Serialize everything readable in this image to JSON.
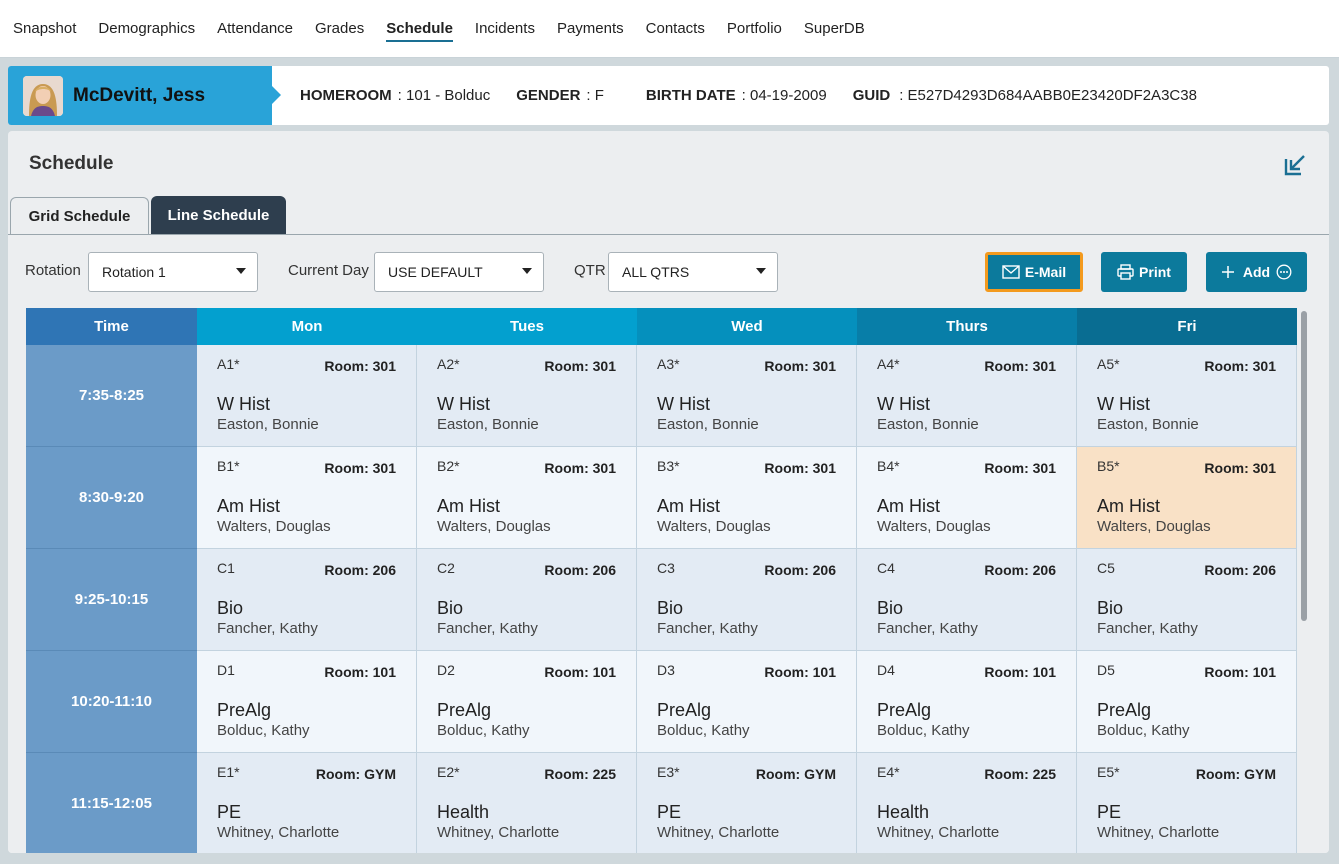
{
  "nav": {
    "items": [
      {
        "label": "Snapshot",
        "name": "nav-snapshot",
        "active": false
      },
      {
        "label": "Demographics",
        "name": "nav-demographics",
        "active": false
      },
      {
        "label": "Attendance",
        "name": "nav-attendance",
        "active": false
      },
      {
        "label": "Grades",
        "name": "nav-grades",
        "active": false
      },
      {
        "label": "Schedule",
        "name": "nav-schedule",
        "active": true
      },
      {
        "label": "Incidents",
        "name": "nav-incidents",
        "active": false
      },
      {
        "label": "Payments",
        "name": "nav-payments",
        "active": false
      },
      {
        "label": "Contacts",
        "name": "nav-contacts",
        "active": false
      },
      {
        "label": "Portfolio",
        "name": "nav-portfolio",
        "active": false
      },
      {
        "label": "SuperDB",
        "name": "nav-superdb",
        "active": false
      }
    ]
  },
  "student": {
    "name": "McDevitt, Jess",
    "homeroom_label": "HOMEROOM",
    "homeroom": ": 101 - Bolduc",
    "gender_label": "GENDER",
    "gender": ": F",
    "birthdate_label": "BIRTH DATE",
    "birthdate": ": 04-19-2009",
    "guid_label": "GUID",
    "guid": ": E527D4293D684AABB0E23420DF2A3C38"
  },
  "panel": {
    "title": "Schedule",
    "tabs": {
      "grid": "Grid Schedule",
      "line": "Line Schedule"
    }
  },
  "filters": {
    "rotation_label": "Rotation",
    "rotation_value": "Rotation 1",
    "current_day_label": "Current Day",
    "current_day_value": "USE DEFAULT",
    "qtr_label": "QTR",
    "qtr_value": "ALL QTRS"
  },
  "buttons": {
    "email": "E-Mail",
    "print": "Print",
    "add": "Add"
  },
  "colors": {
    "accent": "#0c7a9c",
    "highlight_border": "#f39a1e",
    "highlight_cell": "#f9e1c6",
    "time_col": "#6b9bc8",
    "time_header": "#2f75b5",
    "day_headers": [
      "#03a0cf",
      "#03a0cf",
      "#0590bd",
      "#087ea8",
      "#096d92"
    ]
  },
  "grid": {
    "time_header": "Time",
    "days": [
      "Mon",
      "Tues",
      "Wed",
      "Thurs",
      "Fri"
    ],
    "periods": [
      {
        "time": "7:35-8:25",
        "cells": [
          {
            "code": "A1*",
            "room": "Room: 301",
            "course": "W Hist",
            "teacher": "Easton, Bonnie"
          },
          {
            "code": "A2*",
            "room": "Room: 301",
            "course": "W Hist",
            "teacher": "Easton, Bonnie"
          },
          {
            "code": "A3*",
            "room": "Room: 301",
            "course": "W Hist",
            "teacher": "Easton, Bonnie"
          },
          {
            "code": "A4*",
            "room": "Room: 301",
            "course": "W Hist",
            "teacher": "Easton, Bonnie"
          },
          {
            "code": "A5*",
            "room": "Room: 301",
            "course": "W Hist",
            "teacher": "Easton, Bonnie"
          }
        ]
      },
      {
        "time": "8:30-9:20",
        "cells": [
          {
            "code": "B1*",
            "room": "Room: 301",
            "course": "Am Hist",
            "teacher": "Walters, Douglas"
          },
          {
            "code": "B2*",
            "room": "Room: 301",
            "course": "Am Hist",
            "teacher": "Walters, Douglas"
          },
          {
            "code": "B3*",
            "room": "Room: 301",
            "course": "Am Hist",
            "teacher": "Walters, Douglas"
          },
          {
            "code": "B4*",
            "room": "Room: 301",
            "course": "Am Hist",
            "teacher": "Walters, Douglas"
          },
          {
            "code": "B5*",
            "room": "Room: 301",
            "course": "Am Hist",
            "teacher": "Walters, Douglas",
            "highlight": true
          }
        ]
      },
      {
        "time": "9:25-10:15",
        "cells": [
          {
            "code": "C1",
            "room": "Room: 206",
            "course": "Bio",
            "teacher": "Fancher, Kathy"
          },
          {
            "code": "C2",
            "room": "Room: 206",
            "course": "Bio",
            "teacher": "Fancher, Kathy"
          },
          {
            "code": "C3",
            "room": "Room: 206",
            "course": "Bio",
            "teacher": "Fancher, Kathy"
          },
          {
            "code": "C4",
            "room": "Room: 206",
            "course": "Bio",
            "teacher": "Fancher, Kathy"
          },
          {
            "code": "C5",
            "room": "Room: 206",
            "course": "Bio",
            "teacher": "Fancher, Kathy"
          }
        ]
      },
      {
        "time": "10:20-11:10",
        "cells": [
          {
            "code": "D1",
            "room": "Room: 101",
            "course": "PreAlg",
            "teacher": "Bolduc, Kathy"
          },
          {
            "code": "D2",
            "room": "Room: 101",
            "course": "PreAlg",
            "teacher": "Bolduc, Kathy"
          },
          {
            "code": "D3",
            "room": "Room: 101",
            "course": "PreAlg",
            "teacher": "Bolduc, Kathy"
          },
          {
            "code": "D4",
            "room": "Room: 101",
            "course": "PreAlg",
            "teacher": "Bolduc, Kathy"
          },
          {
            "code": "D5",
            "room": "Room: 101",
            "course": "PreAlg",
            "teacher": "Bolduc, Kathy"
          }
        ]
      },
      {
        "time": "11:15-12:05",
        "cells": [
          {
            "code": "E1*",
            "room": "Room: GYM",
            "course": "PE",
            "teacher": "Whitney, Charlotte"
          },
          {
            "code": "E2*",
            "room": "Room: 225",
            "course": "Health",
            "teacher": "Whitney, Charlotte"
          },
          {
            "code": "E3*",
            "room": "Room: GYM",
            "course": "PE",
            "teacher": "Whitney, Charlotte"
          },
          {
            "code": "E4*",
            "room": "Room: 225",
            "course": "Health",
            "teacher": "Whitney, Charlotte"
          },
          {
            "code": "E5*",
            "room": "Room: GYM",
            "course": "PE",
            "teacher": "Whitney, Charlotte"
          }
        ]
      }
    ]
  }
}
